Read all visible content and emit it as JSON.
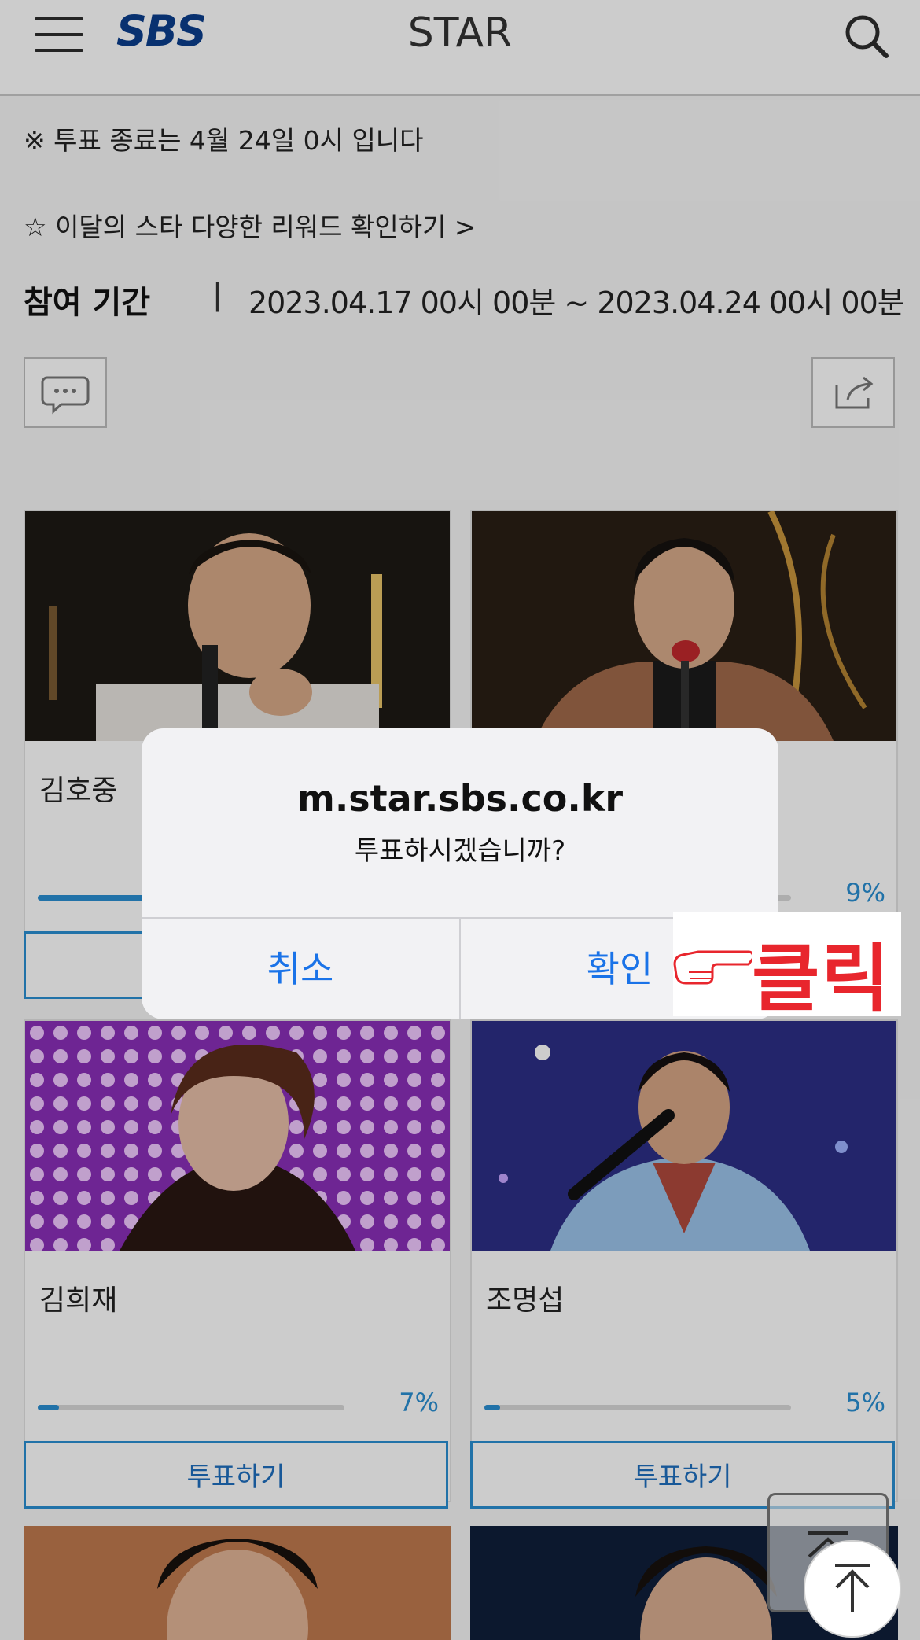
{
  "header": {
    "logo": "SBS",
    "title": "STAR"
  },
  "notice": {
    "vote_end": "※ 투표 종료는 4월 24일 0시 입니다",
    "reward_link": "☆ 이달의 스타 다양한 리워드 확인하기 >"
  },
  "period": {
    "label": "참여 기간",
    "separator": "|",
    "value": "2023.04.17 00시 00분 ~ 2023.04.24 00시 00분"
  },
  "cards": [
    {
      "name": "김호중",
      "percent": "",
      "fill": 0.35,
      "vote_label": ""
    },
    {
      "name": "",
      "percent": "9%",
      "fill": 0.09,
      "vote_label": ""
    },
    {
      "name": "김희재",
      "percent": "7%",
      "fill": 0.07,
      "vote_label": "투표하기"
    },
    {
      "name": "조명섭",
      "percent": "5%",
      "fill": 0.05,
      "vote_label": "투표하기"
    }
  ],
  "dialog": {
    "host": "m.star.sbs.co.kr",
    "message": "투표하시겠습니까?",
    "cancel": "취소",
    "confirm": "확인"
  },
  "annotation": {
    "text": "클릭"
  },
  "colors": {
    "accent": "#2a8fd3",
    "dialog_button": "#1a73e8",
    "annotation": "#e8262d",
    "logo": "#0b3e8c"
  }
}
